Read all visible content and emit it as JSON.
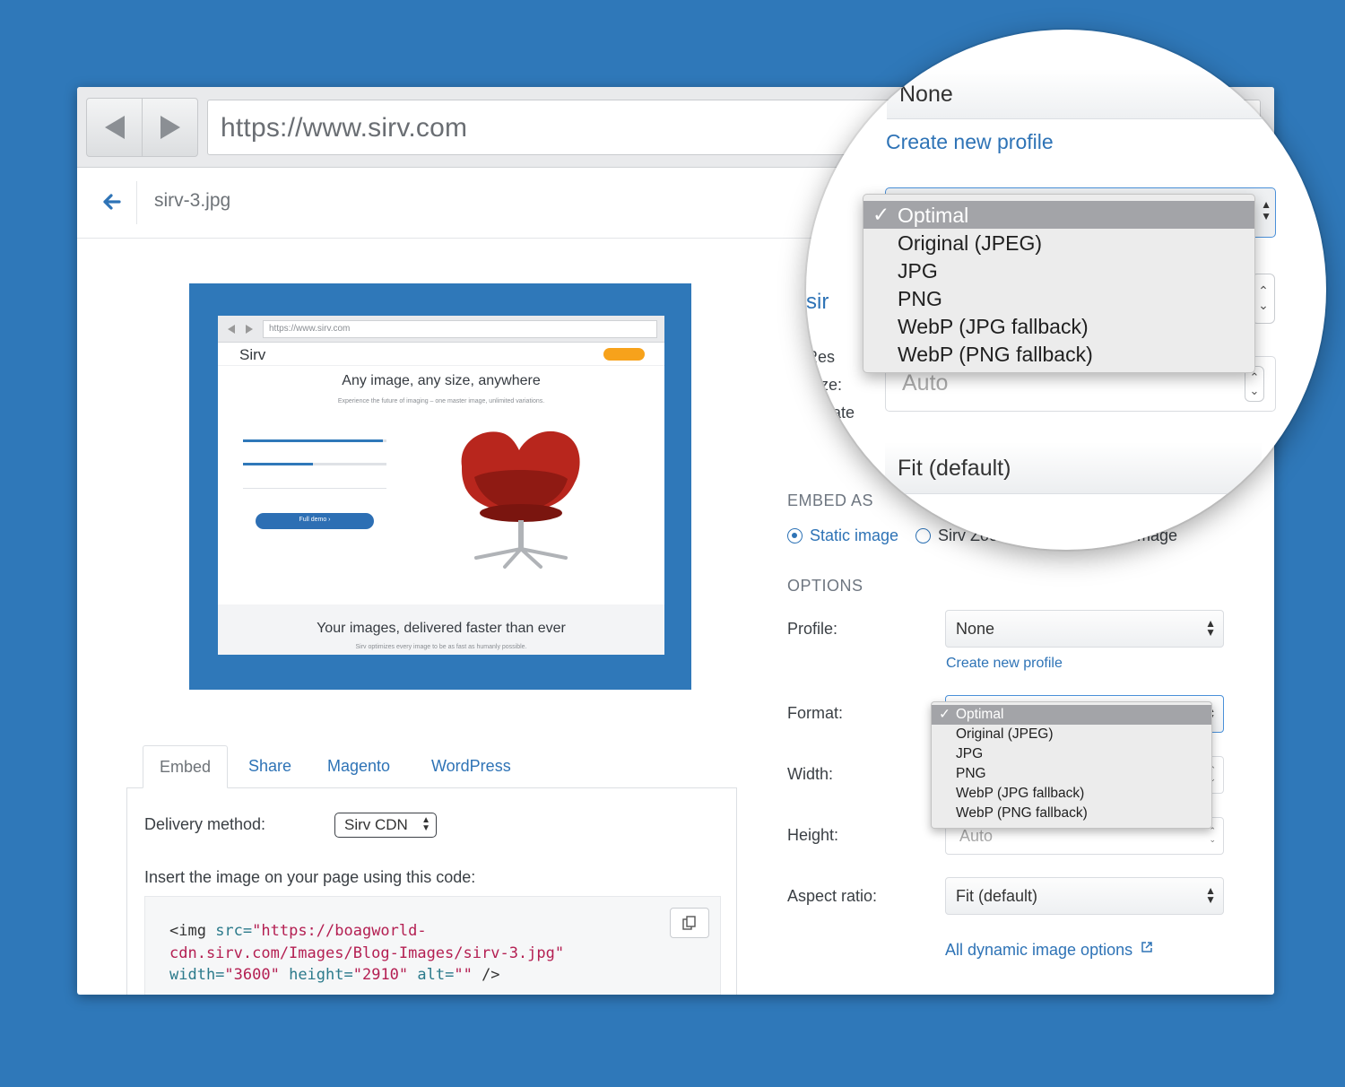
{
  "browser": {
    "url": "https://www.sirv.com"
  },
  "breadcrumb": {
    "filename": "sirv-3.jpg"
  },
  "preview": {
    "url": "https://www.sirv.com",
    "logo": "Sirv",
    "headline": "Any image, any size, anywhere",
    "subhead": "Experience the future of imaging – one master image, unlimited variations.",
    "cta": "Full demo ›",
    "footer_title": "Your images, delivered faster than ever",
    "footer_sub": "Sirv optimizes every image to be as fast as humanly possible."
  },
  "tabs": [
    {
      "label": "Embed",
      "active": true
    },
    {
      "label": "Share"
    },
    {
      "label": "Magento"
    },
    {
      "label": "WordPress"
    }
  ],
  "embed": {
    "delivery_label": "Delivery method:",
    "delivery_value": "Sirv CDN",
    "insert_text": "Insert the image on your page using this code:",
    "code_tag": "<img",
    "code_src_attr": " src=",
    "code_src_val1": "\"https://boagworld-",
    "code_src_val2": "cdn.sirv.com/Images/Blog-Images/sirv-3.jpg\"",
    "code_width_attr": "width=",
    "code_width_val": "\"3600\"",
    "code_height_attr": " height=",
    "code_height_val": "\"2910\"",
    "code_alt_attr": " alt=",
    "code_alt_val": "\"\"",
    "code_close": " />"
  },
  "right": {
    "embed_as_heading": "EMBED AS",
    "radio_static": "Static image",
    "radio_zoom": "Sirv Zoo",
    "radio_tail": "mage",
    "options_heading": "OPTIONS",
    "profile_label": "Profile:",
    "profile_value": "None",
    "create_profile": "Create new profile",
    "format_label": "Format:",
    "width_label": "Width:",
    "height_label": "Height:",
    "height_value": "Auto",
    "aspect_label": "Aspect ratio:",
    "aspect_value": "Fit (default)",
    "all_options": "All dynamic image options",
    "format_options": [
      "Optimal",
      "Original (JPEG)",
      "JPG",
      "PNG",
      "WebP (JPG fallback)",
      "WebP (PNG fallback)"
    ],
    "format_selected": "Optimal"
  },
  "magnifier": {
    "profile_value": "None",
    "create_profile": "Create new profile",
    "height_value": "Auto",
    "aspect_value": "Fit (default)",
    "left_sir": "sir",
    "left_res": "Res",
    "left_size": "Size:",
    "left_create": "Create"
  },
  "colors": {
    "background": "#2f78b9",
    "link": "#2e73b6",
    "selected_option": "#a3a4a8"
  }
}
